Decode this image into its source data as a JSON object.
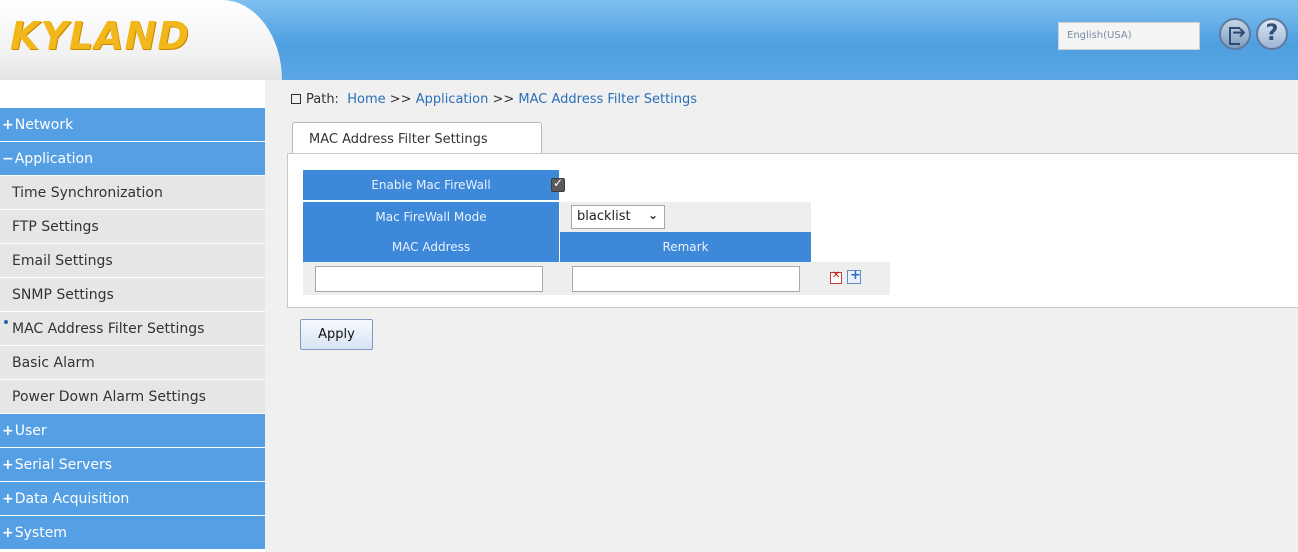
{
  "header": {
    "logo": "KYLAND",
    "language": "English(USA)"
  },
  "sidebar": {
    "items": [
      {
        "sign": "+",
        "label": "Network",
        "type": "category"
      },
      {
        "sign": "−",
        "label": "Application",
        "type": "category"
      },
      {
        "label": "Time Synchronization",
        "type": "sub"
      },
      {
        "label": "FTP Settings",
        "type": "sub"
      },
      {
        "label": "Email Settings",
        "type": "sub"
      },
      {
        "label": "SNMP Settings",
        "type": "sub"
      },
      {
        "label": "MAC Address Filter Settings",
        "type": "sub",
        "active": true
      },
      {
        "label": "Basic Alarm",
        "type": "sub"
      },
      {
        "label": "Power Down Alarm Settings",
        "type": "sub"
      },
      {
        "sign": "+",
        "label": "User",
        "type": "category"
      },
      {
        "sign": "+",
        "label": "Serial Servers",
        "type": "category"
      },
      {
        "sign": "+",
        "label": "Data Acquisition",
        "type": "category"
      },
      {
        "sign": "+",
        "label": "System",
        "type": "category"
      }
    ]
  },
  "main": {
    "path_label": "Path:",
    "breadcrumb": [
      "Home",
      "Application",
      "MAC Address Filter Settings"
    ],
    "breadcrumb_sep": ">>",
    "tab": "MAC Address Filter Settings",
    "form": {
      "enable_label": "Enable Mac FireWall",
      "enable_checked": true,
      "mode_label": "Mac FireWall Mode",
      "mode_value": "blacklist",
      "col_mac": "MAC Address",
      "col_remark": "Remark",
      "mac_value": "",
      "remark_value": ""
    },
    "apply_label": "Apply"
  },
  "colors": {
    "header_blue": "#4f9fe0",
    "sidebar_category": "#559fe4",
    "label_cell": "#3d88d9",
    "logo": "#f2b81b"
  }
}
